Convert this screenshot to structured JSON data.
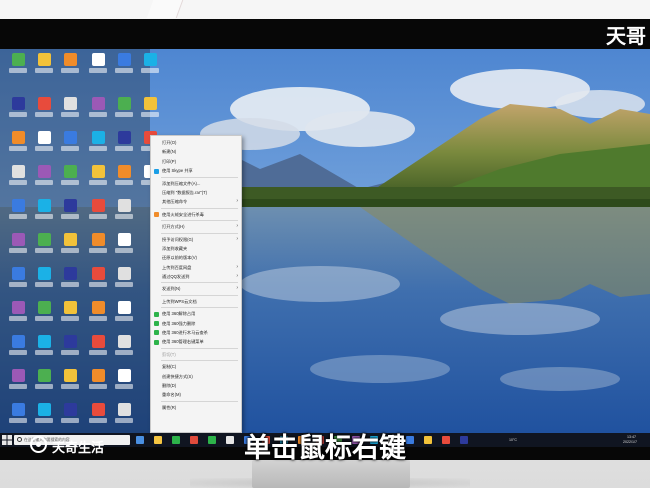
{
  "overlay": {
    "watermark": "天哥",
    "subtitle": "单击鼠标右键",
    "brand_name": "天奇生活"
  },
  "context_menu": {
    "items": [
      {
        "label": "打开(O)",
        "type": "item"
      },
      {
        "label": "新建(N)",
        "type": "item"
      },
      {
        "label": "打印(P)",
        "type": "item"
      },
      {
        "label": "使用 Skype 共享",
        "type": "item",
        "icon": "skype-icon"
      },
      {
        "type": "separator"
      },
      {
        "label": "添加到压缩文件(A)...",
        "type": "item"
      },
      {
        "label": "压缩到 \"数据报告.rar\"(T)",
        "type": "item"
      },
      {
        "label": "其他压缩命令",
        "type": "submenu"
      },
      {
        "type": "separator"
      },
      {
        "label": "使用火绒安全进行杀毒",
        "type": "item",
        "icon": "shield-icon"
      },
      {
        "type": "separator"
      },
      {
        "label": "打开方式(H)",
        "type": "submenu"
      },
      {
        "type": "separator"
      },
      {
        "label": "授予访问权限(G)",
        "type": "submenu"
      },
      {
        "label": "添加到收藏夹",
        "type": "item"
      },
      {
        "label": "还原以前的版本(V)",
        "type": "item"
      },
      {
        "label": "上传到百度网盘",
        "type": "submenu"
      },
      {
        "label": "通过QQ发送到",
        "type": "submenu"
      },
      {
        "type": "separator"
      },
      {
        "label": "发送到(N)",
        "type": "submenu"
      },
      {
        "type": "separator"
      },
      {
        "label": "上传到WPS云文档",
        "type": "item"
      },
      {
        "type": "separator"
      },
      {
        "label": "使用 360解除占用",
        "type": "item",
        "icon": "360-icon"
      },
      {
        "label": "使用 360强力删除",
        "type": "item",
        "icon": "360-icon"
      },
      {
        "label": "使用 360进行木马云查杀",
        "type": "item",
        "icon": "360-icon"
      },
      {
        "label": "使用 360管理右键菜单",
        "type": "item",
        "icon": "360-icon"
      },
      {
        "type": "separator"
      },
      {
        "label": "剪切(T)",
        "type": "item",
        "disabled": true
      },
      {
        "type": "separator"
      },
      {
        "label": "复制(C)",
        "type": "item"
      },
      {
        "label": "创建快捷方式(S)",
        "type": "item"
      },
      {
        "label": "删除(D)",
        "type": "item"
      },
      {
        "label": "重命名(M)",
        "type": "item"
      },
      {
        "type": "separator"
      },
      {
        "label": "属性(R)",
        "type": "item"
      }
    ]
  },
  "taskbar": {
    "search_placeholder": "在这里输入你要搜索的内容",
    "tray_temp": "10°C",
    "tray_time": "13:47",
    "tray_date": "2022/1/7"
  },
  "colors": {
    "sky": "#5b8fd6",
    "water": "#2a5fae",
    "forest": "#4d6b2a",
    "taskbar": "#101521",
    "menu_bg": "#f4f4f4"
  }
}
